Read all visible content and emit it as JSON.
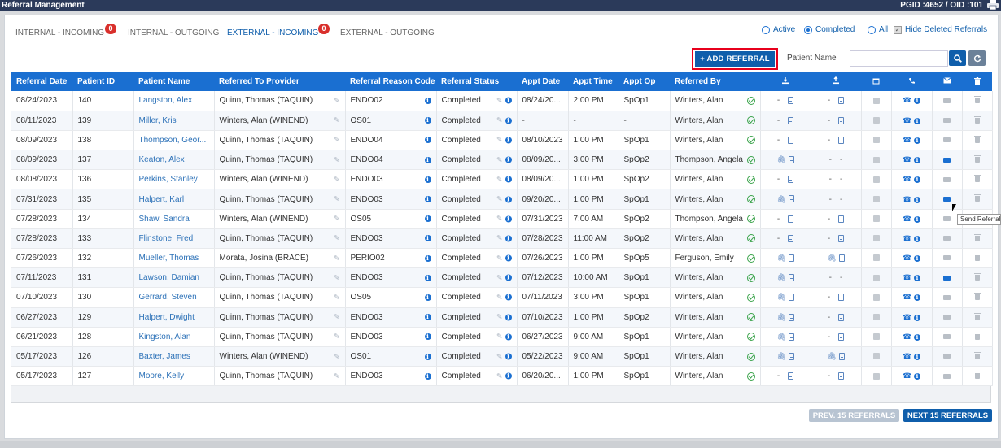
{
  "window": {
    "title": "Referral Management",
    "ids": "PGID :4652 / OID :101"
  },
  "tabs": [
    {
      "label": "INTERNAL - INCOMING",
      "badge": "0"
    },
    {
      "label": "INTERNAL - OUTGOING",
      "badge": ""
    },
    {
      "label": "EXTERNAL - INCOMING",
      "badge": "0",
      "active": true
    },
    {
      "label": "EXTERNAL - OUTGOING",
      "badge": ""
    }
  ],
  "filters": {
    "active": "Active",
    "completed": "Completed",
    "all": "All",
    "hide_deleted": "Hide Deleted Referrals",
    "selected": "Completed"
  },
  "toolbar": {
    "add_label": "+ ADD REFERRAL",
    "patient_name_label": "Patient Name",
    "patient_name_value": ""
  },
  "columns": [
    "Referral Date",
    "Patient ID",
    "Patient Name",
    "Referred To Provider",
    "Referral Reason Code",
    "Referral Status",
    "Appt Date",
    "Appt Time",
    "Appt Op",
    "Referred By"
  ],
  "icon_columns": [
    "download-icon",
    "upload-icon",
    "calendar-icon",
    "phone-icon",
    "envelope-icon",
    "trash-icon"
  ],
  "rows": [
    {
      "date": "08/24/2023",
      "pid": "140",
      "name": "Langston, Alex",
      "provider": "Quinn, Thomas (TAQUIN)",
      "reason": "ENDO02",
      "status": "Completed",
      "appt_date": "08/24/20...",
      "appt_time": "2:00 PM",
      "op": "SpOp1",
      "by": "Winters, Alan",
      "dl_clip": false,
      "ul": "-",
      "mail_blue": false
    },
    {
      "date": "08/11/2023",
      "pid": "139",
      "name": "Miller, Kris",
      "provider": "Winters, Alan (WINEND)",
      "reason": "OS01",
      "status": "Completed",
      "appt_date": "-",
      "appt_time": "-",
      "op": "-",
      "by": "Winters, Alan",
      "dl_clip": false,
      "ul": "-",
      "mail_blue": false
    },
    {
      "date": "08/09/2023",
      "pid": "138",
      "name": "Thompson, Geor...",
      "provider": "Quinn, Thomas (TAQUIN)",
      "reason": "ENDO04",
      "status": "Completed",
      "appt_date": "08/10/2023",
      "appt_time": "1:00 PM",
      "op": "SpOp1",
      "by": "Winters, Alan",
      "dl_clip": false,
      "ul": "-",
      "mail_blue": false
    },
    {
      "date": "08/09/2023",
      "pid": "137",
      "name": "Keaton, Alex",
      "provider": "Quinn, Thomas (TAQUIN)",
      "reason": "ENDO04",
      "status": "Completed",
      "appt_date": "08/09/20...",
      "appt_time": "3:00 PM",
      "op": "SpOp2",
      "by": "Thompson, Angela",
      "dl_clip": true,
      "ul": "- -",
      "mail_blue": true
    },
    {
      "date": "08/08/2023",
      "pid": "136",
      "name": "Perkins, Stanley",
      "provider": "Winters, Alan (WINEND)",
      "reason": "ENDO03",
      "status": "Completed",
      "appt_date": "08/09/20...",
      "appt_time": "1:00 PM",
      "op": "SpOp2",
      "by": "Winters, Alan",
      "dl_clip": false,
      "ul": "- -",
      "mail_blue": false
    },
    {
      "date": "07/31/2023",
      "pid": "135",
      "name": "Halpert, Karl",
      "provider": "Quinn, Thomas (TAQUIN)",
      "reason": "ENDO03",
      "status": "Completed",
      "appt_date": "09/20/20...",
      "appt_time": "1:00 PM",
      "op": "SpOp1",
      "by": "Winters, Alan",
      "dl_clip": true,
      "ul": "- -",
      "mail_blue": true
    },
    {
      "date": "07/28/2023",
      "pid": "134",
      "name": "Shaw, Sandra",
      "provider": "Winters, Alan (WINEND)",
      "reason": "OS05",
      "status": "Completed",
      "appt_date": "07/31/2023",
      "appt_time": "7:00 AM",
      "op": "SpOp2",
      "by": "Thompson, Angela",
      "dl_clip": false,
      "ul": "-",
      "mail_blue": false
    },
    {
      "date": "07/28/2023",
      "pid": "133",
      "name": "Flinstone, Fred",
      "provider": "Quinn, Thomas (TAQUIN)",
      "reason": "ENDO03",
      "status": "Completed",
      "appt_date": "07/28/2023",
      "appt_time": "11:00 AM",
      "op": "SpOp2",
      "by": "Winters, Alan",
      "dl_clip": false,
      "ul": "-",
      "mail_blue": false
    },
    {
      "date": "07/26/2023",
      "pid": "132",
      "name": "Mueller, Thomas",
      "provider": "Morata, Josina (BRACE)",
      "reason": "PERIO02",
      "status": "Completed",
      "appt_date": "07/26/2023",
      "appt_time": "1:00 PM",
      "op": "SpOp5",
      "by": "Ferguson, Emily",
      "dl_clip": true,
      "ul": "clip",
      "mail_blue": false
    },
    {
      "date": "07/11/2023",
      "pid": "131",
      "name": "Lawson, Damian",
      "provider": "Quinn, Thomas (TAQUIN)",
      "reason": "ENDO03",
      "status": "Completed",
      "appt_date": "07/12/2023",
      "appt_time": "10:00 AM",
      "op": "SpOp1",
      "by": "Winters, Alan",
      "dl_clip": true,
      "ul": "- -",
      "mail_blue": true
    },
    {
      "date": "07/10/2023",
      "pid": "130",
      "name": "Gerrard, Steven",
      "provider": "Quinn, Thomas (TAQUIN)",
      "reason": "OS05",
      "status": "Completed",
      "appt_date": "07/11/2023",
      "appt_time": "3:00 PM",
      "op": "SpOp1",
      "by": "Winters, Alan",
      "dl_clip": true,
      "ul": "-",
      "mail_blue": false
    },
    {
      "date": "06/27/2023",
      "pid": "129",
      "name": "Halpert, Dwight",
      "provider": "Quinn, Thomas (TAQUIN)",
      "reason": "ENDO03",
      "status": "Completed",
      "appt_date": "07/10/2023",
      "appt_time": "1:00 PM",
      "op": "SpOp2",
      "by": "Winters, Alan",
      "dl_clip": true,
      "ul": "-",
      "mail_blue": false
    },
    {
      "date": "06/21/2023",
      "pid": "128",
      "name": "Kingston, Alan",
      "provider": "Quinn, Thomas (TAQUIN)",
      "reason": "ENDO03",
      "status": "Completed",
      "appt_date": "06/27/2023",
      "appt_time": "9:00 AM",
      "op": "SpOp1",
      "by": "Winters, Alan",
      "dl_clip": true,
      "ul": "-",
      "mail_blue": false
    },
    {
      "date": "05/17/2023",
      "pid": "126",
      "name": "Baxter, James",
      "provider": "Winters, Alan (WINEND)",
      "reason": "OS01",
      "status": "Completed",
      "appt_date": "05/22/2023",
      "appt_time": "9:00 AM",
      "op": "SpOp1",
      "by": "Winters, Alan",
      "dl_clip": true,
      "ul": "clip",
      "mail_blue": false
    },
    {
      "date": "05/17/2023",
      "pid": "127",
      "name": "Moore, Kelly",
      "provider": "Quinn, Thomas (TAQUIN)",
      "reason": "ENDO03",
      "status": "Completed",
      "appt_date": "06/20/20...",
      "appt_time": "1:00 PM",
      "op": "SpOp1",
      "by": "Winters, Alan",
      "dl_clip": false,
      "ul": "-",
      "mail_blue": false
    }
  ],
  "tooltip": "Send Referral",
  "pagination": {
    "prev": "PREV. 15 REFERRALS",
    "next": "NEXT 15 REFERRALS"
  }
}
